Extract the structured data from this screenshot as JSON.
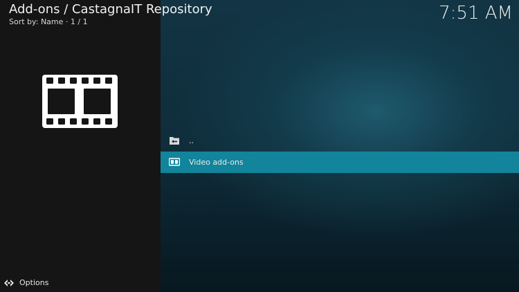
{
  "header": {
    "title": "Add-ons / CastagnaIT Repository",
    "sort_info": "Sort by: Name  ·  1 / 1"
  },
  "clock": "7:51 AM",
  "preview": {
    "icon": "film-strip-icon"
  },
  "list": {
    "items": [
      {
        "label": "..",
        "icon": "folder-back-icon",
        "focused": false
      },
      {
        "label": "Video add-ons",
        "icon": "film-icon",
        "focused": true
      }
    ]
  },
  "footer": {
    "options_label": "Options",
    "options_icon": "options-arrows-icon"
  },
  "colors": {
    "focus_highlight": "#12849c",
    "left_panel": "#151515",
    "background_accent": "#1f5c70"
  }
}
